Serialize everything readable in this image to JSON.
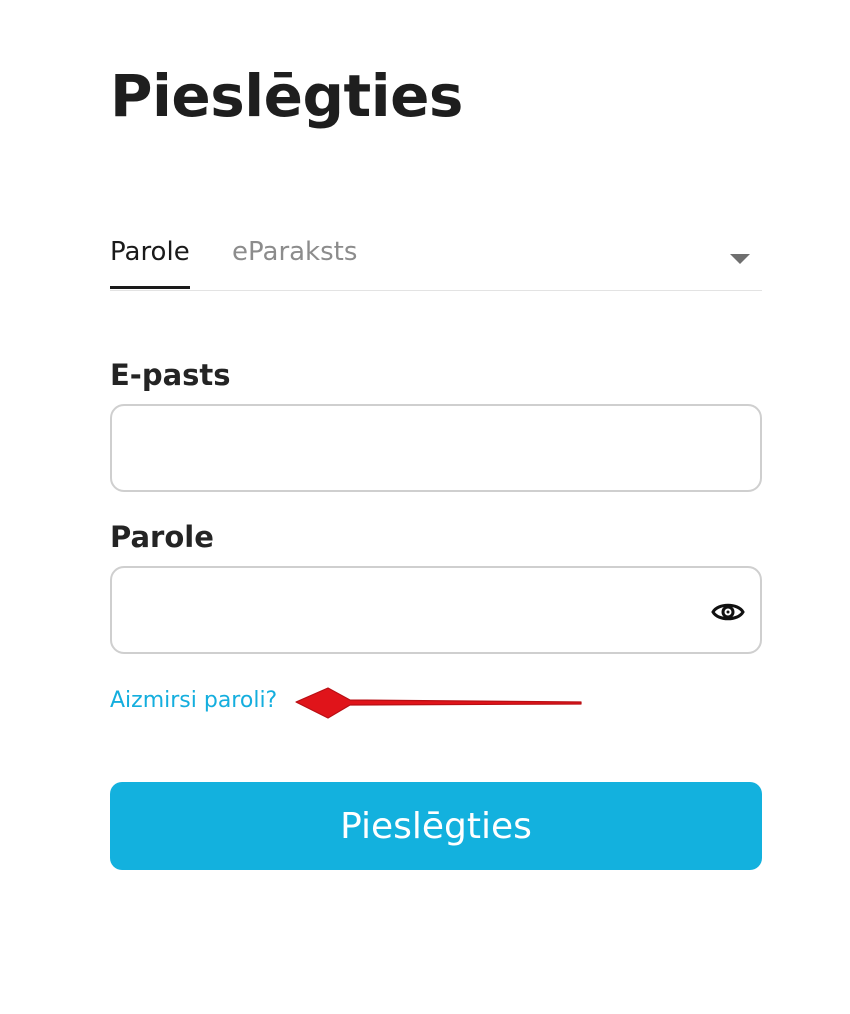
{
  "page": {
    "title": "Pieslēgties"
  },
  "tabs": {
    "items": [
      {
        "label": "Parole",
        "active": true
      },
      {
        "label": "eParaksts",
        "active": false
      }
    ],
    "dropdown_icon": "caret-down-icon"
  },
  "form": {
    "email": {
      "label": "E-pasts",
      "value": "",
      "placeholder": ""
    },
    "password": {
      "label": "Parole",
      "value": "",
      "placeholder": "",
      "toggle_icon": "eye-icon"
    },
    "forgot_link": "Aizmirsi paroli?",
    "submit_label": "Pieslēgties"
  },
  "annotation": {
    "icon": "red-arrow-icon",
    "color": "#e0141a"
  },
  "colors": {
    "accent": "#13b1de",
    "link": "#14aede",
    "text": "#1e1e1e",
    "muted": "#8c8c8c",
    "border": "#cfcfcf"
  }
}
